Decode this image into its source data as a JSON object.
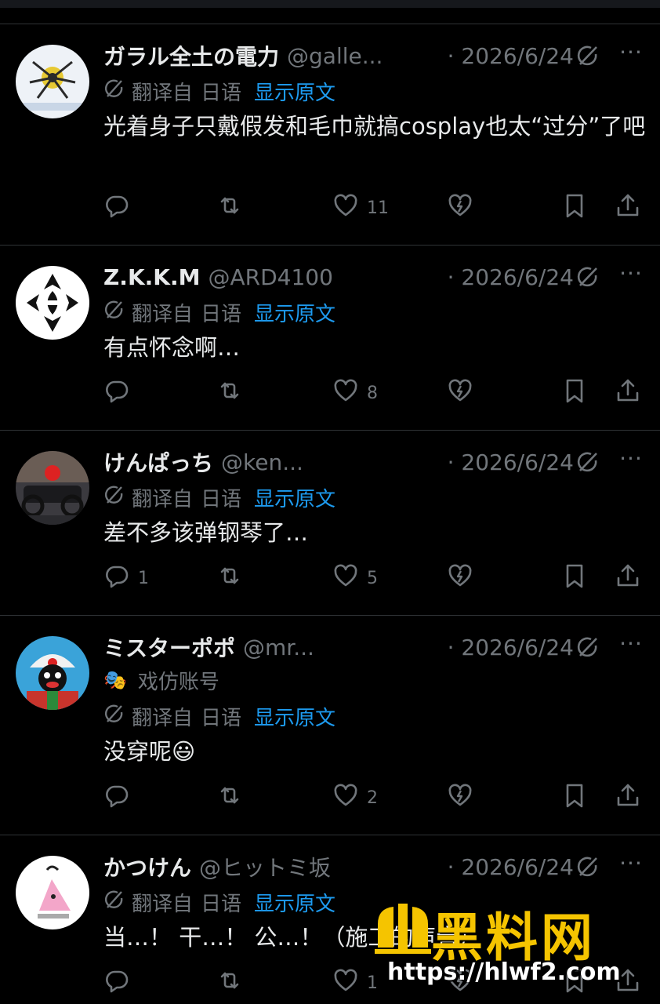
{
  "tweets": [
    {
      "name": "ガラル全土の電力",
      "handle": "@galle...",
      "date": "· 2026/6/24",
      "parody": null,
      "translated_from": "翻译自",
      "language": "日语",
      "show_original": "显示原文",
      "text": "光着身子只戴假发和毛巾就搞cosplay也太“过分”了吧",
      "reply_count": "",
      "retweet_count": "",
      "like_count": "11"
    },
    {
      "name": "Z.K.K.M",
      "handle": "@ARD4100",
      "date": "· 2026/6/24",
      "parody": null,
      "translated_from": "翻译自",
      "language": "日语",
      "show_original": "显示原文",
      "text": "有点怀念啊…",
      "reply_count": "",
      "retweet_count": "",
      "like_count": "8"
    },
    {
      "name": "けんぱっち",
      "handle": "@ken...",
      "date": "· 2026/6/24",
      "parody": null,
      "translated_from": "翻译自",
      "language": "日语",
      "show_original": "显示原文",
      "text": "差不多该弹钢琴了…",
      "reply_count": "1",
      "retweet_count": "",
      "like_count": "5"
    },
    {
      "name": "ミスターポポ",
      "handle": "@mr...",
      "date": "· 2026/6/24",
      "parody": "戏仿账号",
      "translated_from": "翻译自",
      "language": "日语",
      "show_original": "显示原文",
      "text": "没穿呢😃",
      "reply_count": "",
      "retweet_count": "",
      "like_count": "2"
    },
    {
      "name": "かつけん",
      "handle": "@ヒットミ坂",
      "date": "· 2026/6/24",
      "parody": null,
      "translated_from": "翻译自",
      "language": "日语",
      "show_original": "显示原文",
      "text": "当…！ 干…！ 公…！（施工的声音）",
      "reply_count": "",
      "retweet_count": "",
      "like_count": "1"
    }
  ],
  "watermark": {
    "title": "黑料网",
    "url": "https://hlwf2.com"
  },
  "colors": {
    "background": "#000000",
    "text": "#e7e9ea",
    "muted": "#71767b",
    "link": "#1d9bf0",
    "watermark": "#f5c400"
  }
}
